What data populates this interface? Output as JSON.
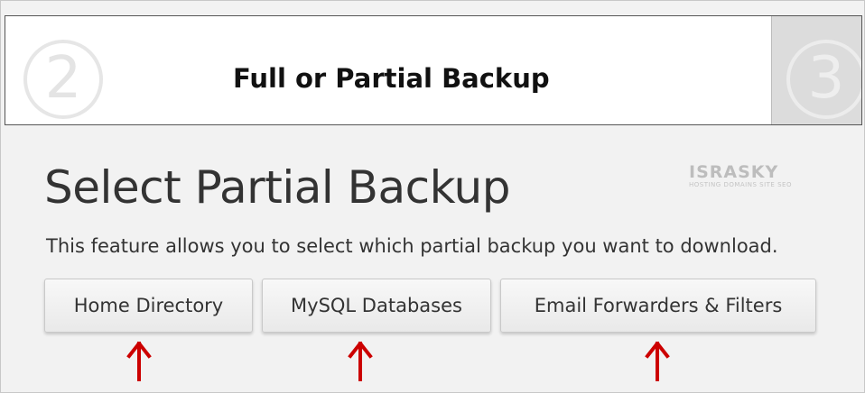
{
  "step_bar": {
    "left_step_number": "2",
    "right_step_number": "3",
    "title": "Full or Partial Backup"
  },
  "main": {
    "title": "Select Partial Backup",
    "description": "This feature allows you to select which partial backup you want to download."
  },
  "logo": {
    "name": "ISRASKY",
    "tagline": "HOSTING DOMAINS SITE SEO"
  },
  "buttons": [
    {
      "label": "Home Directory"
    },
    {
      "label": "MySQL Databases"
    },
    {
      "label": "Email Forwarders & Filters"
    }
  ],
  "colors": {
    "arrow": "#cc0000",
    "text": "#333333",
    "background": "#f2f2f2"
  },
  "icons": {
    "arrow": "arrow-up-icon"
  }
}
